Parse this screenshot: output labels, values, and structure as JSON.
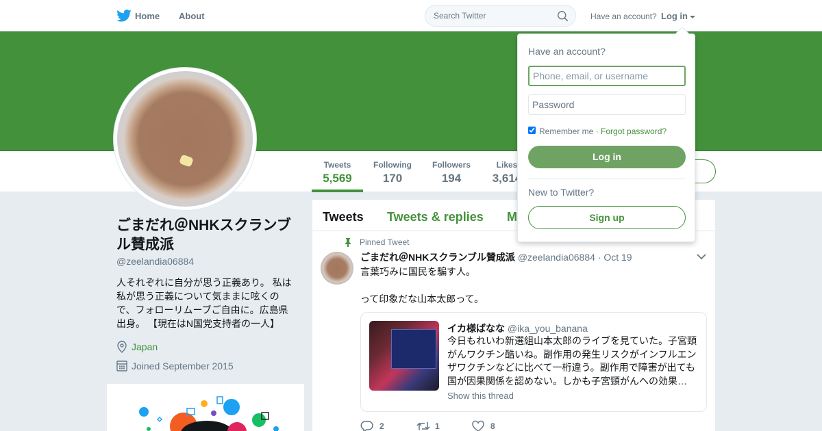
{
  "topbar": {
    "home_label": "Home",
    "about_label": "About",
    "search_placeholder": "Search Twitter",
    "have_account": "Have an account?",
    "login_label": "Log in"
  },
  "colors": {
    "accent": "#44913b",
    "banner": "#44913b",
    "button": "#6fa364"
  },
  "stats": [
    {
      "label": "Tweets",
      "value": "5,569"
    },
    {
      "label": "Following",
      "value": "170"
    },
    {
      "label": "Followers",
      "value": "194"
    },
    {
      "label": "Likes",
      "value": "3,614"
    }
  ],
  "profile": {
    "name": "ごまだれ＠NHKスクランブル賛成派",
    "handle": "@zeelandia06884",
    "bio": "人それぞれに自分が思う正義あり。 私は私が思う正義について気ままに呟くので、フォローリムーブご自由に。広島県出身。 【現在はN国党支持者の一人】",
    "location": "Japan",
    "joined": "Joined September 2015"
  },
  "tabs": [
    "Tweets",
    "Tweets & replies",
    "Media"
  ],
  "tweet": {
    "pinned_label": "Pinned Tweet",
    "name": "ごまだれ＠NHKスクランブル賛成派",
    "handle": "@zeelandia06884",
    "date": "· Oct 19",
    "text_line1": "言葉巧みに国民を騙す人。",
    "text_line2": "って印象だな山本太郎って。",
    "quote": {
      "name": "イカ様ばなな",
      "handle": "@ika_you_banana",
      "text": "今日もれいわ新選組山本太郎のライブを見ていた。子宮頸がんワクチン酷いね。副作用の発生リスクがインフルエンザワクチンなどに比べて一桁違う。副作用で障害が出ても国が因果関係を認めない。しかも子宮頸がんへの効果…",
      "thread_label": "Show this thread"
    },
    "replies": "2",
    "retweets": "1",
    "likes": "8"
  },
  "login_dropdown": {
    "title": "Have an account?",
    "username_placeholder": "Phone, email, or username",
    "password_placeholder": "Password",
    "remember_label": "Remember me",
    "separator": " · ",
    "forgot_label": "Forgot password?",
    "login_button": "Log in",
    "new_label": "New to Twitter?",
    "signup_button": "Sign up"
  }
}
